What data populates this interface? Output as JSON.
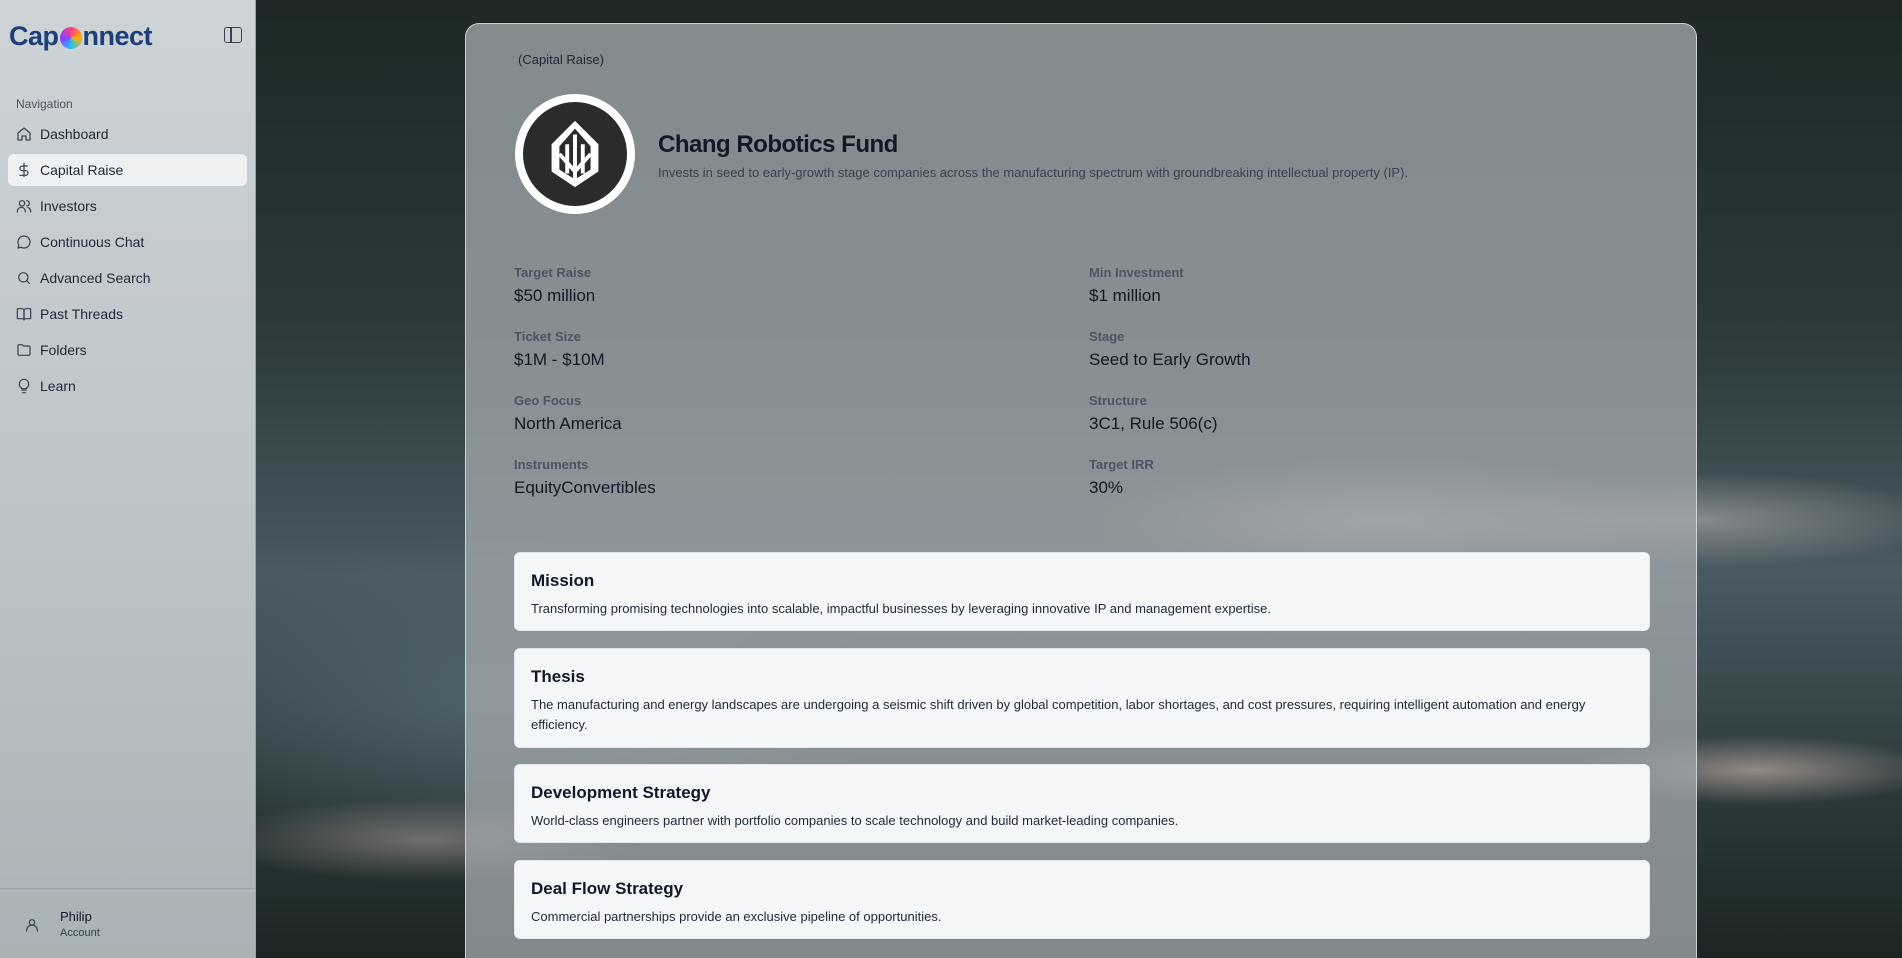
{
  "app": {
    "name_part1": "Cap",
    "name_part2": "nnect"
  },
  "sidebar": {
    "nav_title": "Navigation",
    "items": [
      {
        "label": "Dashboard",
        "icon": "home-icon"
      },
      {
        "label": "Capital Raise",
        "icon": "dollar-icon",
        "active": true
      },
      {
        "label": "Investors",
        "icon": "users-icon"
      },
      {
        "label": "Continuous Chat",
        "icon": "chat-icon"
      },
      {
        "label": "Advanced Search",
        "icon": "search-icon"
      },
      {
        "label": "Past Threads",
        "icon": "book-icon"
      },
      {
        "label": "Folders",
        "icon": "folder-icon"
      },
      {
        "label": "Learn",
        "icon": "lightbulb-icon"
      }
    ],
    "account": {
      "name": "Philip",
      "sub": "Account"
    }
  },
  "main": {
    "breadcrumb": "(Capital Raise)",
    "fund": {
      "name": "Chang Robotics Fund",
      "description": "Invests in seed to early-growth stage companies across the manufacturing spectrum with groundbreaking intellectual property (IP)."
    },
    "metrics": [
      {
        "label": "Target Raise",
        "value": "$50 million"
      },
      {
        "label": "Min Investment",
        "value": "$1 million"
      },
      {
        "label": "Ticket Size",
        "value": "$1M - $10M"
      },
      {
        "label": "Stage",
        "value": "Seed to Early Growth"
      },
      {
        "label": "Geo Focus",
        "value": "North America"
      },
      {
        "label": "Structure",
        "value": "3C1, Rule 506(c)"
      },
      {
        "label": "Instruments",
        "value": "EquityConvertibles"
      },
      {
        "label": "Target IRR",
        "value": "30%"
      }
    ],
    "sections": [
      {
        "title": "Mission",
        "text": "Transforming promising technologies into scalable, impactful businesses by leveraging innovative IP and management expertise."
      },
      {
        "title": "Thesis",
        "text": "The manufacturing and energy landscapes are undergoing a seismic shift driven by global competition, labor shortages, and cost pressures, requiring intelligent automation and energy efficiency."
      },
      {
        "title": "Development Strategy",
        "text": "World-class engineers partner with portfolio companies to scale technology and build market-leading companies."
      },
      {
        "title": "Deal Flow Strategy",
        "text": "Commercial partnerships provide an exclusive pipeline of opportunities."
      }
    ]
  }
}
